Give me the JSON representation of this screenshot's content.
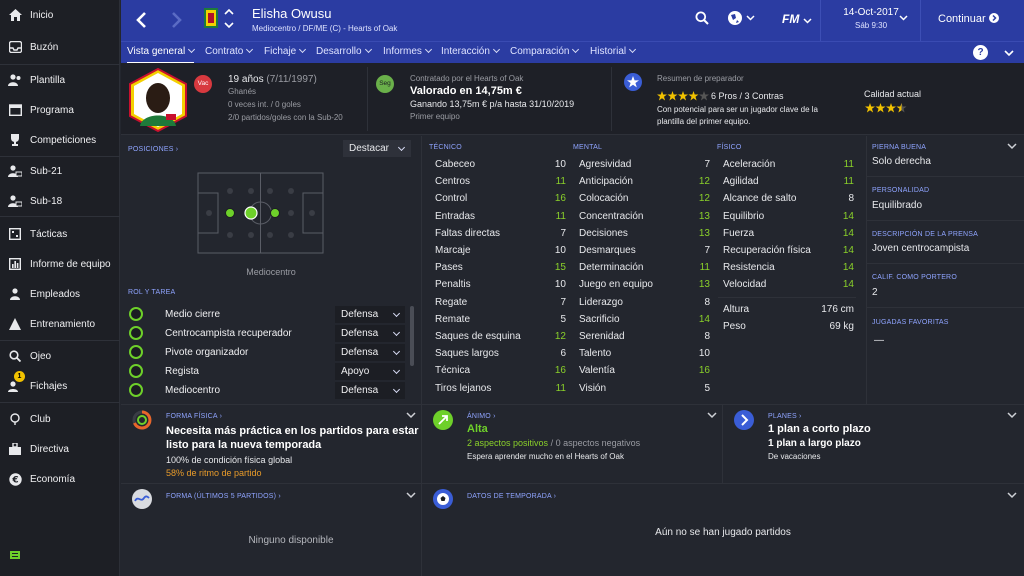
{
  "sidebar": {
    "items": [
      {
        "label": "Inicio",
        "icon": "home-icon"
      },
      {
        "label": "Buzón",
        "icon": "inbox-icon"
      },
      {
        "label": "Plantilla",
        "icon": "squad-icon"
      },
      {
        "label": "Programa",
        "icon": "calendar-icon"
      },
      {
        "label": "Competiciones",
        "icon": "trophy-icon"
      },
      {
        "label": "Sub-21",
        "icon": "u21-icon"
      },
      {
        "label": "Sub-18",
        "icon": "u18-icon"
      },
      {
        "label": "Tácticas",
        "icon": "tactics-icon"
      },
      {
        "label": "Informe de equipo",
        "icon": "report-icon"
      },
      {
        "label": "Empleados",
        "icon": "staff-icon"
      },
      {
        "label": "Entrenamiento",
        "icon": "training-icon"
      },
      {
        "label": "Ojeo",
        "icon": "scouting-icon"
      },
      {
        "label": "Fichajes",
        "icon": "transfers-icon",
        "badge": "1"
      },
      {
        "label": "Club",
        "icon": "club-icon"
      },
      {
        "label": "Directiva",
        "icon": "board-icon"
      },
      {
        "label": "Economía",
        "icon": "finances-icon"
      }
    ]
  },
  "topbar": {
    "player_name": "Elisha Owusu",
    "player_sub": "Mediocentro / DF/ME (C) - Hearts of Oak",
    "date": "14-Oct-2017",
    "day_time": "Sáb 9:30",
    "continue_label": "Continuar",
    "logo": "FM"
  },
  "nav": {
    "tabs": [
      "Vista general",
      "Contrato",
      "Fichaje",
      "Desarrollo",
      "Informes",
      "Interacción",
      "Comparación",
      "Historial"
    ],
    "help": "?"
  },
  "header": {
    "age": "19 años",
    "dob": "(7/11/1997)",
    "nationality": "Ghanés",
    "caps": "0 veces int. / 0 goles",
    "u20": "2/0 partidos/goles con la Sub-20",
    "badge_vac": "Vac",
    "badge_seg": "Seg",
    "contract_by": "Contratado por el Hearts of Oak",
    "value": "Valorado en 14,75m €",
    "wage": "Ganando 13,75m € p/a hasta 31/10/2019",
    "squad_status": "Primer equipo",
    "coach_title": "Resumen de preparador",
    "coach_pros": "6 Pros / 3 Contras",
    "coach_text1": "Con potencial para ser un jugador clave de la",
    "coach_text2": "plantilla del primer equipo.",
    "current_ability": "Calidad actual",
    "potential_stars": 4,
    "current_stars": 3.5
  },
  "positions": {
    "title": "POSICIONES",
    "highlight": "Destacar",
    "caption": "Mediocentro"
  },
  "roles": {
    "title": "ROL Y TAREA",
    "items": [
      {
        "name": "Medio cierre",
        "duty": "Defensa"
      },
      {
        "name": "Centrocampista recuperador",
        "duty": "Defensa"
      },
      {
        "name": "Pivote organizador",
        "duty": "Defensa"
      },
      {
        "name": "Regista",
        "duty": "Apoyo"
      },
      {
        "name": "Mediocentro",
        "duty": "Defensa"
      }
    ]
  },
  "technical": {
    "title": "TÉCNICO",
    "items": [
      {
        "name": "Cabeceo",
        "value": "10",
        "hi": false
      },
      {
        "name": "Centros",
        "value": "11",
        "hi": true
      },
      {
        "name": "Control",
        "value": "16",
        "hi": true
      },
      {
        "name": "Entradas",
        "value": "11",
        "hi": true
      },
      {
        "name": "Faltas directas",
        "value": "7",
        "hi": false
      },
      {
        "name": "Marcaje",
        "value": "10",
        "hi": false
      },
      {
        "name": "Pases",
        "value": "15",
        "hi": true
      },
      {
        "name": "Penaltis",
        "value": "10",
        "hi": false
      },
      {
        "name": "Regate",
        "value": "7",
        "hi": false
      },
      {
        "name": "Remate",
        "value": "5",
        "hi": false
      },
      {
        "name": "Saques de esquina",
        "value": "12",
        "hi": true
      },
      {
        "name": "Saques largos",
        "value": "6",
        "hi": false
      },
      {
        "name": "Técnica",
        "value": "16",
        "hi": true
      },
      {
        "name": "Tiros lejanos",
        "value": "11",
        "hi": true
      }
    ]
  },
  "mental": {
    "title": "MENTAL",
    "items": [
      {
        "name": "Agresividad",
        "value": "7",
        "hi": false
      },
      {
        "name": "Anticipación",
        "value": "12",
        "hi": true
      },
      {
        "name": "Colocación",
        "value": "12",
        "hi": true
      },
      {
        "name": "Concentración",
        "value": "13",
        "hi": true
      },
      {
        "name": "Decisiones",
        "value": "13",
        "hi": true
      },
      {
        "name": "Desmarques",
        "value": "7",
        "hi": false
      },
      {
        "name": "Determinación",
        "value": "11",
        "hi": true
      },
      {
        "name": "Juego en equipo",
        "value": "13",
        "hi": true
      },
      {
        "name": "Liderazgo",
        "value": "8",
        "hi": false
      },
      {
        "name": "Sacrificio",
        "value": "14",
        "hi": true
      },
      {
        "name": "Serenidad",
        "value": "8",
        "hi": false
      },
      {
        "name": "Talento",
        "value": "10",
        "hi": false
      },
      {
        "name": "Valentía",
        "value": "16",
        "hi": true
      },
      {
        "name": "Visión",
        "value": "5",
        "hi": false
      }
    ]
  },
  "physical": {
    "title": "FÍSICO",
    "items": [
      {
        "name": "Aceleración",
        "value": "11",
        "hi": true
      },
      {
        "name": "Agilidad",
        "value": "11",
        "hi": true
      },
      {
        "name": "Alcance de salto",
        "value": "8",
        "hi": false
      },
      {
        "name": "Equilibrio",
        "value": "14",
        "hi": true
      },
      {
        "name": "Fuerza",
        "value": "14",
        "hi": true
      },
      {
        "name": "Recuperación física",
        "value": "14",
        "hi": true
      },
      {
        "name": "Resistencia",
        "value": "14",
        "hi": true
      },
      {
        "name": "Velocidad",
        "value": "14",
        "hi": true
      }
    ],
    "height_label": "Altura",
    "height": "176 cm",
    "weight_label": "Peso",
    "weight": "69 kg"
  },
  "info": {
    "foot_label": "PIERNA BUENA",
    "foot": "Solo derecha",
    "personality_label": "PERSONALIDAD",
    "personality": "Equilibrado",
    "press_label": "DESCRIPCIÓN DE LA PRENSA",
    "press": "Joven centrocampista",
    "gk_label": "CALIF. COMO PORTERO",
    "gk": "2",
    "ppm_label": "JUGADAS FAVORITAS",
    "ppm": "—"
  },
  "fitness": {
    "title": "FORMA FÍSICA",
    "line1": "Necesita más práctica en los partidos para estar",
    "line2": "listo para la nueva temporada",
    "condition": "100% de condición física global",
    "match": "58% de ritmo de partido"
  },
  "morale": {
    "title": "ÁNIMO",
    "value": "Alta",
    "positive": "2 aspectos positivos",
    "negative": "0 aspectos negativos",
    "note": "Espera aprender mucho en el Hearts of Oak"
  },
  "plans": {
    "title": "PLANES",
    "short": "1 plan a corto plazo",
    "long": "1 plan a largo plazo",
    "holiday": "De vacaciones"
  },
  "form": {
    "title": "FORMA (ÚLTIMOS 5 PARTIDOS)",
    "empty": "Ninguno disponible"
  },
  "season": {
    "title": "DATOS DE TEMPORADA",
    "empty": "Aún no se han jugado partidos"
  },
  "colors": {
    "accent": "#2b3ca2",
    "highlight": "#8ad02a",
    "label": "#8fa4ff",
    "morale": "#6ed02a",
    "match_fitness": "#e89b2a"
  }
}
